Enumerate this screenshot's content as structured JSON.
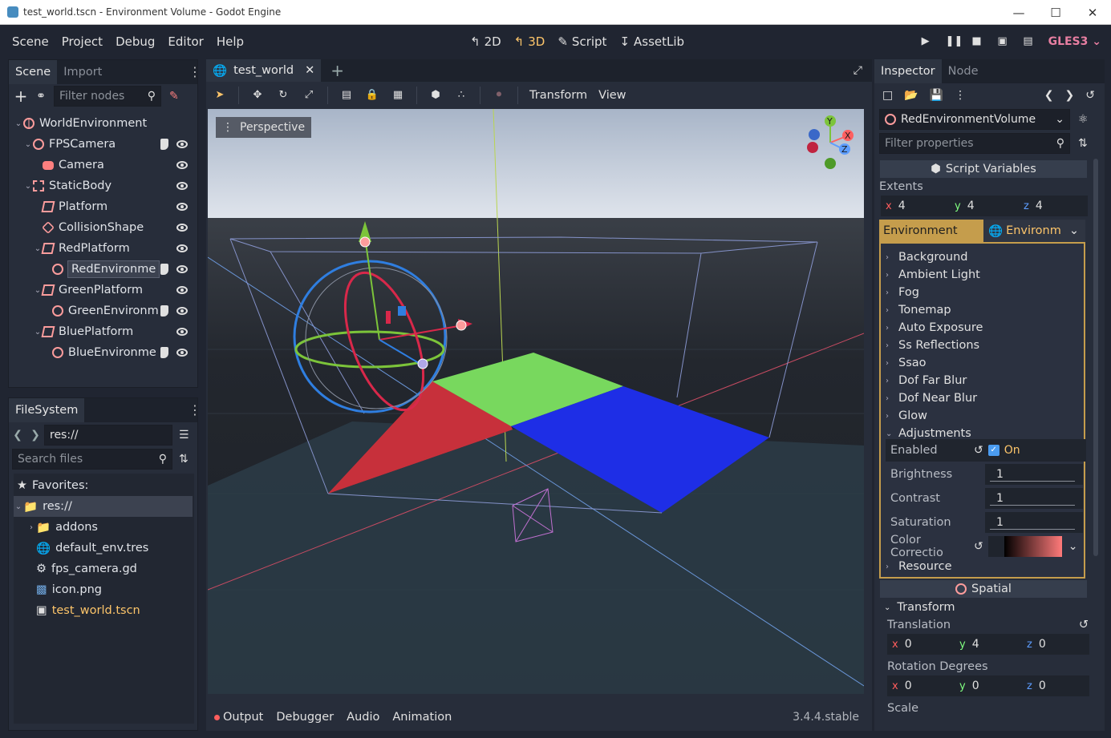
{
  "window": {
    "title": "test_world.tscn - Environment Volume - Godot Engine"
  },
  "menu": [
    "Scene",
    "Project",
    "Debug",
    "Editor",
    "Help"
  ],
  "modes": [
    {
      "label": "2D",
      "active": false
    },
    {
      "label": "3D",
      "active": true
    },
    {
      "label": "Script",
      "active": false
    },
    {
      "label": "AssetLib",
      "active": false
    }
  ],
  "renderer": "GLES3",
  "scene_dock": {
    "tabs": [
      "Scene",
      "Import"
    ],
    "filter_placeholder": "Filter nodes",
    "nodes": [
      {
        "label": "WorldEnvironment",
        "depth": 0,
        "icon": "world-icon"
      },
      {
        "label": "FPSCamera",
        "depth": 1,
        "icon": "circle-icon"
      },
      {
        "label": "Camera",
        "depth": 2,
        "icon": "camera-icon"
      },
      {
        "label": "StaticBody",
        "depth": 1,
        "icon": "box-icon"
      },
      {
        "label": "Platform",
        "depth": 2,
        "icon": "mesh-icon"
      },
      {
        "label": "CollisionShape",
        "depth": 2,
        "icon": "shape-icon"
      },
      {
        "label": "RedPlatform",
        "depth": 2,
        "icon": "mesh-icon"
      },
      {
        "label": "RedEnvironme",
        "depth": 3,
        "icon": "circle-icon"
      },
      {
        "label": "GreenPlatform",
        "depth": 2,
        "icon": "mesh-icon"
      },
      {
        "label": "GreenEnvironm",
        "depth": 3,
        "icon": "circle-icon"
      },
      {
        "label": "BluePlatform",
        "depth": 2,
        "icon": "mesh-icon"
      },
      {
        "label": "BlueEnvironme",
        "depth": 3,
        "icon": "circle-icon"
      }
    ]
  },
  "filesystem": {
    "tab": "FileSystem",
    "path": "res://",
    "search_placeholder": "Search files",
    "items": [
      {
        "label": "Favorites:",
        "depth": 0
      },
      {
        "label": "res://",
        "depth": 0
      },
      {
        "label": "addons",
        "depth": 1
      },
      {
        "label": "default_env.tres",
        "depth": 1
      },
      {
        "label": "fps_camera.gd",
        "depth": 1
      },
      {
        "label": "icon.png",
        "depth": 1
      },
      {
        "label": "test_world.tscn",
        "depth": 1
      }
    ]
  },
  "viewport": {
    "tab": "test_world",
    "menus": [
      "Transform",
      "View"
    ],
    "perspective": "Perspective",
    "gizmo_labels": {
      "x": "X",
      "y": "Y",
      "z": "Z"
    }
  },
  "bottom": {
    "tabs": [
      "Output",
      "Debugger",
      "Audio",
      "Animation"
    ],
    "version": "3.4.4.stable"
  },
  "inspector": {
    "tabs": [
      "Inspector",
      "Node"
    ],
    "node_name": "RedEnvironmentVolume",
    "filter_placeholder": "Filter properties",
    "script_section": "Script Variables",
    "extents_label": "Extents",
    "extents": {
      "x": "4",
      "y": "4",
      "z": "4"
    },
    "env_label": "Environment",
    "env_value": "Environm",
    "env_groups": [
      "Background",
      "Ambient Light",
      "Fog",
      "Tonemap",
      "Auto Exposure",
      "Ss Reflections",
      "Ssao",
      "Dof Far Blur",
      "Dof Near Blur",
      "Glow",
      "Adjustments"
    ],
    "adjustments": {
      "enabled_label": "Enabled",
      "enabled_value": "On",
      "brightness_label": "Brightness",
      "brightness": "1",
      "contrast_label": "Contrast",
      "contrast": "1",
      "saturation_label": "Saturation",
      "saturation": "1",
      "color_correction_label": "Color Correctio",
      "resource_label": "Resource"
    },
    "spatial_section": "Spatial",
    "transform_label": "Transform",
    "translation_label": "Translation",
    "translation": {
      "x": "0",
      "y": "4",
      "z": "0"
    },
    "rotation_label": "Rotation Degrees",
    "rotation": {
      "x": "0",
      "y": "0",
      "z": "0"
    },
    "scale_label": "Scale"
  },
  "colors": {
    "accent": "#fdc56a",
    "env_border": "#c59d4c",
    "red": "#c7303b",
    "green": "#78d85e",
    "blue": "#1e2ee6"
  }
}
